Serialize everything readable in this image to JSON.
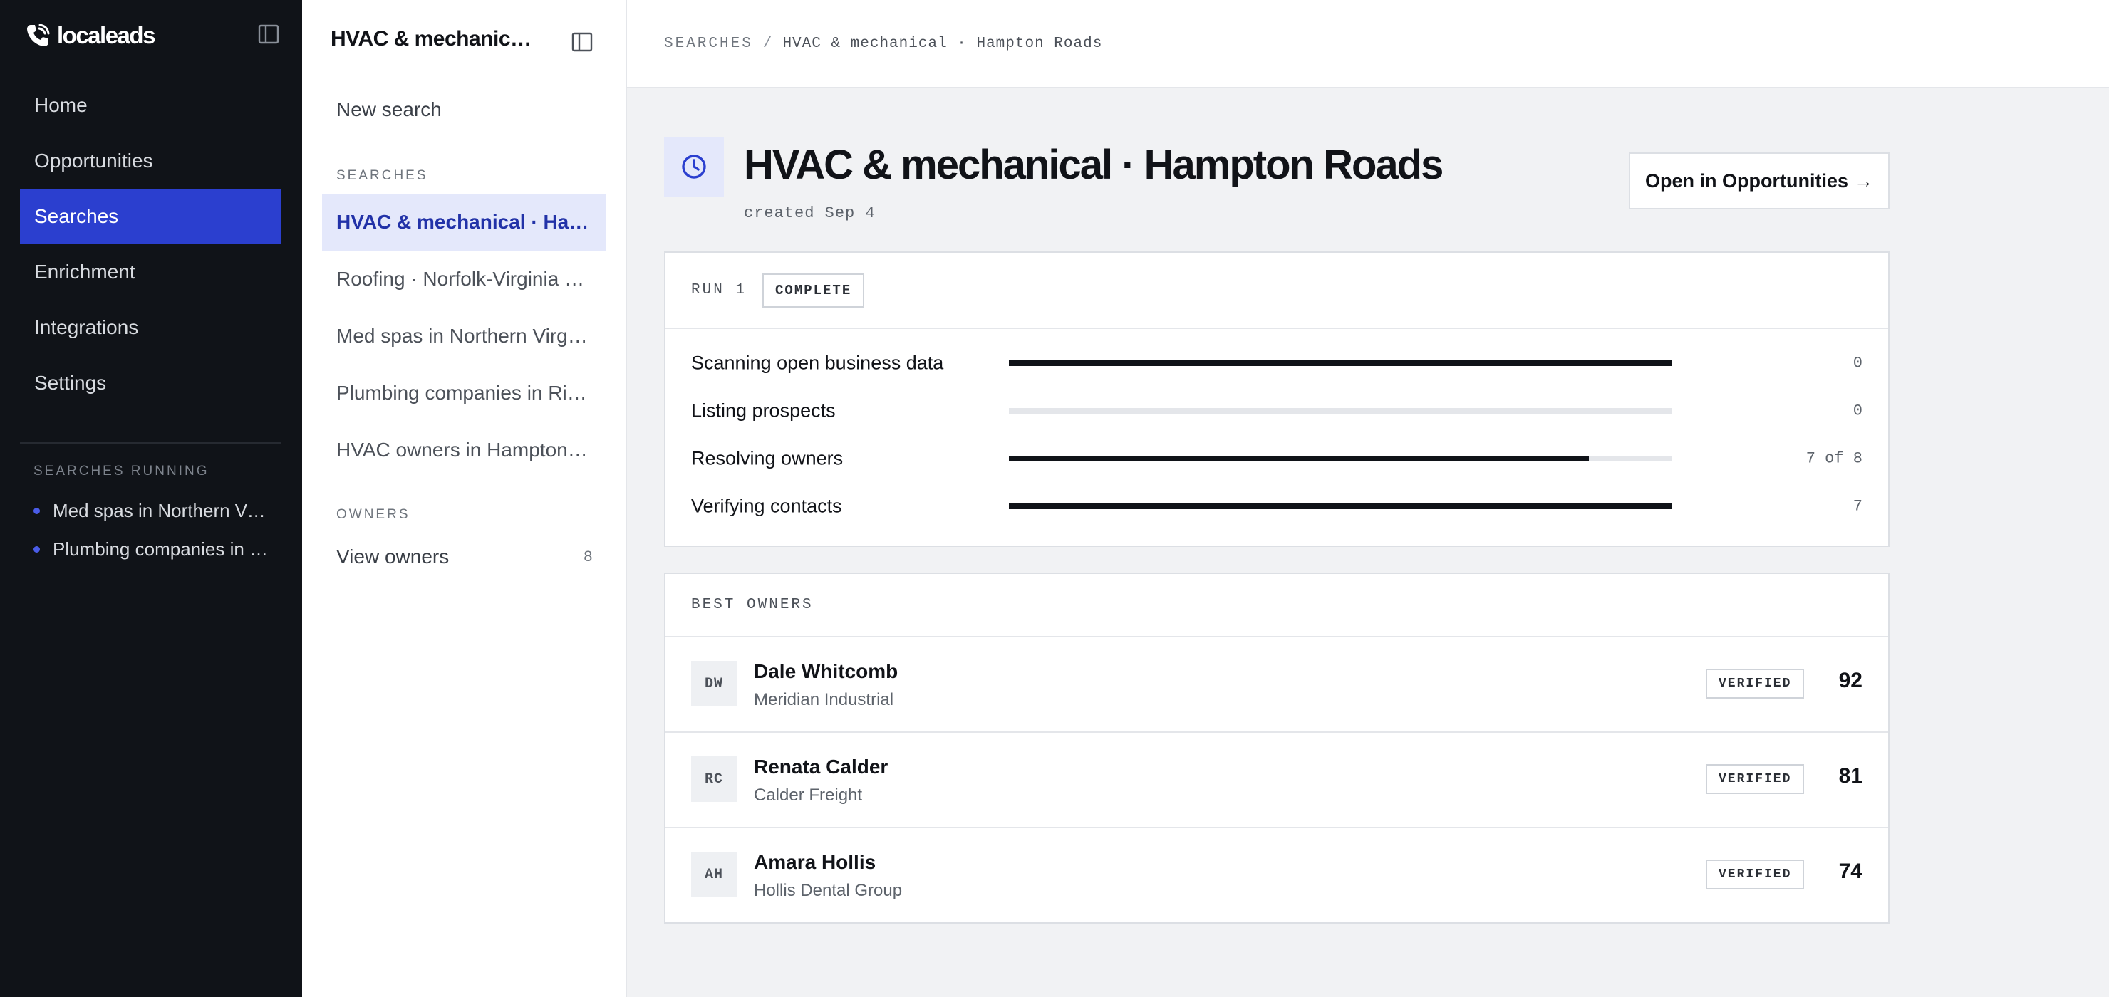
{
  "brand": {
    "name": "localeads"
  },
  "nav": {
    "items": [
      {
        "label": "Home",
        "active": false
      },
      {
        "label": "Opportunities",
        "active": false
      },
      {
        "label": "Searches",
        "active": true
      },
      {
        "label": "Enrichment",
        "active": false
      },
      {
        "label": "Integrations",
        "active": false
      },
      {
        "label": "Settings",
        "active": false
      }
    ]
  },
  "running": {
    "heading": "SEARCHES RUNNING",
    "items": [
      {
        "label": "Med spas in Northern Virginia"
      },
      {
        "label": "Plumbing companies in Richmond"
      }
    ]
  },
  "panel": {
    "title": "HVAC & mechanical · Hampton Roads",
    "new_search": "New search",
    "searches_heading": "SEARCHES",
    "searches": [
      {
        "label": "HVAC & mechanical · Hampton Roads",
        "active": true
      },
      {
        "label": "Roofing · Norfolk-Virginia Beach",
        "active": false
      },
      {
        "label": "Med spas in Northern Virginia",
        "active": false
      },
      {
        "label": "Plumbing companies in Richmond",
        "active": false
      },
      {
        "label": "HVAC owners in Hampton Roads",
        "active": false
      }
    ],
    "owners_heading": "OWNERS",
    "view_owners": "View owners",
    "owners_count": "8"
  },
  "breadcrumb": {
    "root": "SEARCHES",
    "sep": "/",
    "current": "HVAC & mechanical · Hampton Roads"
  },
  "header": {
    "title": "HVAC & mechanical · Hampton Roads",
    "created": "created Sep 4",
    "open_button": "Open in Opportunities",
    "open_arrow": "→"
  },
  "run": {
    "label": "RUN 1",
    "status": "COMPLETE",
    "steps": [
      {
        "name": "Scanning open business data",
        "progress": 1.0,
        "count": "0"
      },
      {
        "name": "Listing prospects",
        "progress": 0.0,
        "count": "0"
      },
      {
        "name": "Resolving owners",
        "progress": 0.875,
        "count": "7 of 8"
      },
      {
        "name": "Verifying contacts",
        "progress": 1.0,
        "count": "7"
      }
    ]
  },
  "best_owners": {
    "heading": "BEST OWNERS",
    "owners": [
      {
        "initials": "DW",
        "name": "Dale Whitcomb",
        "company": "Meridian Industrial",
        "badge": "VERIFIED",
        "score": "92"
      },
      {
        "initials": "RC",
        "name": "Renata Calder",
        "company": "Calder Freight",
        "badge": "VERIFIED",
        "score": "81"
      },
      {
        "initials": "AH",
        "name": "Amara Hollis",
        "company": "Hollis Dental Group",
        "badge": "VERIFIED",
        "score": "74"
      }
    ]
  },
  "colors": {
    "accent": "#2b3fcf",
    "sidebar_bg": "#101318",
    "active_search_bg": "#e4e8fb",
    "bar": "#101318"
  },
  "icons": {
    "brand": "phone-icon",
    "collapse": "sidebar-collapse-icon",
    "clock": "clock-icon",
    "running": "dot-icon"
  }
}
